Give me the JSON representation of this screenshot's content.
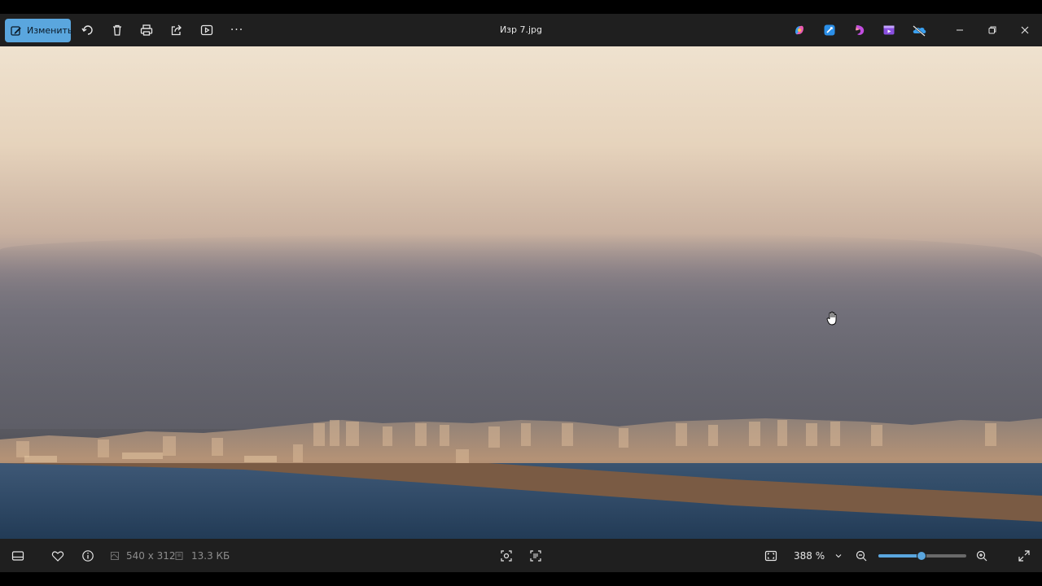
{
  "toolbar": {
    "edit_label": "Изменить",
    "icons": [
      "edit-icon",
      "rotate-icon",
      "delete-icon",
      "print-icon",
      "share-icon",
      "slideshow-icon",
      "more-icon"
    ],
    "more_label": "···"
  },
  "window": {
    "title": "Изр 7.jpg"
  },
  "apps": [
    "copilot-icon",
    "clipchamp-icon",
    "designer-icon",
    "video-editor-icon",
    "onedrive-icon"
  ],
  "window_controls": [
    "minimize-icon",
    "restore-icon",
    "close-icon"
  ],
  "footer": {
    "dimensions": "540 x 312",
    "file_size": "13.3 КБ",
    "zoom": "388 %",
    "zoom_fraction": 0.49
  },
  "colors": {
    "accent": "#5aa6de",
    "bar_bg": "#1f1f1f"
  }
}
